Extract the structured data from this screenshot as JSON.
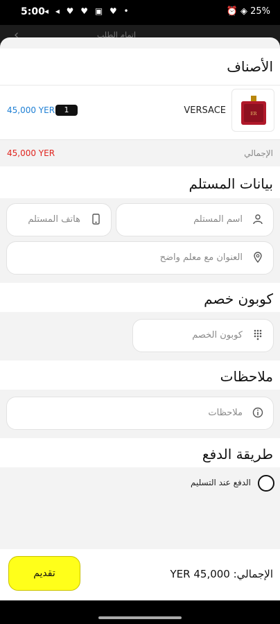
{
  "status_bar": {
    "time": "5:00",
    "icons": "◂ ◂ ♥ ♥ ▣ ♥ •",
    "right": "⏰ ◈ 25%"
  },
  "app_bar": {
    "title": "إتمام الطلب"
  },
  "items_section": {
    "title": "الأصناف",
    "item": {
      "name": "VERSACE",
      "qty": "1",
      "price": "45,000 YER"
    },
    "total_label": "الإجمالي",
    "total_value": "45,000 YER"
  },
  "recipient": {
    "title": "بيانات المستلم",
    "name_placeholder": "اسم المستلم",
    "phone_placeholder": "هاتف المستلم",
    "address_placeholder": "العنوان مع معلم واضح"
  },
  "coupon": {
    "title": "كوبون خصم",
    "placeholder": "كوبون الخصم"
  },
  "notes": {
    "title": "ملاحظات",
    "placeholder": "ملاحظات"
  },
  "payment": {
    "title": "طريقة الدفع",
    "option_cod": "الدفع عند التسليم"
  },
  "footer": {
    "total_text": "الإجمالي: 45,000 YER",
    "submit_label": "تقديم"
  },
  "colors": {
    "accent_yellow": "#ffff1a",
    "price_blue": "#1e7fd4",
    "price_red": "#e0251f"
  }
}
